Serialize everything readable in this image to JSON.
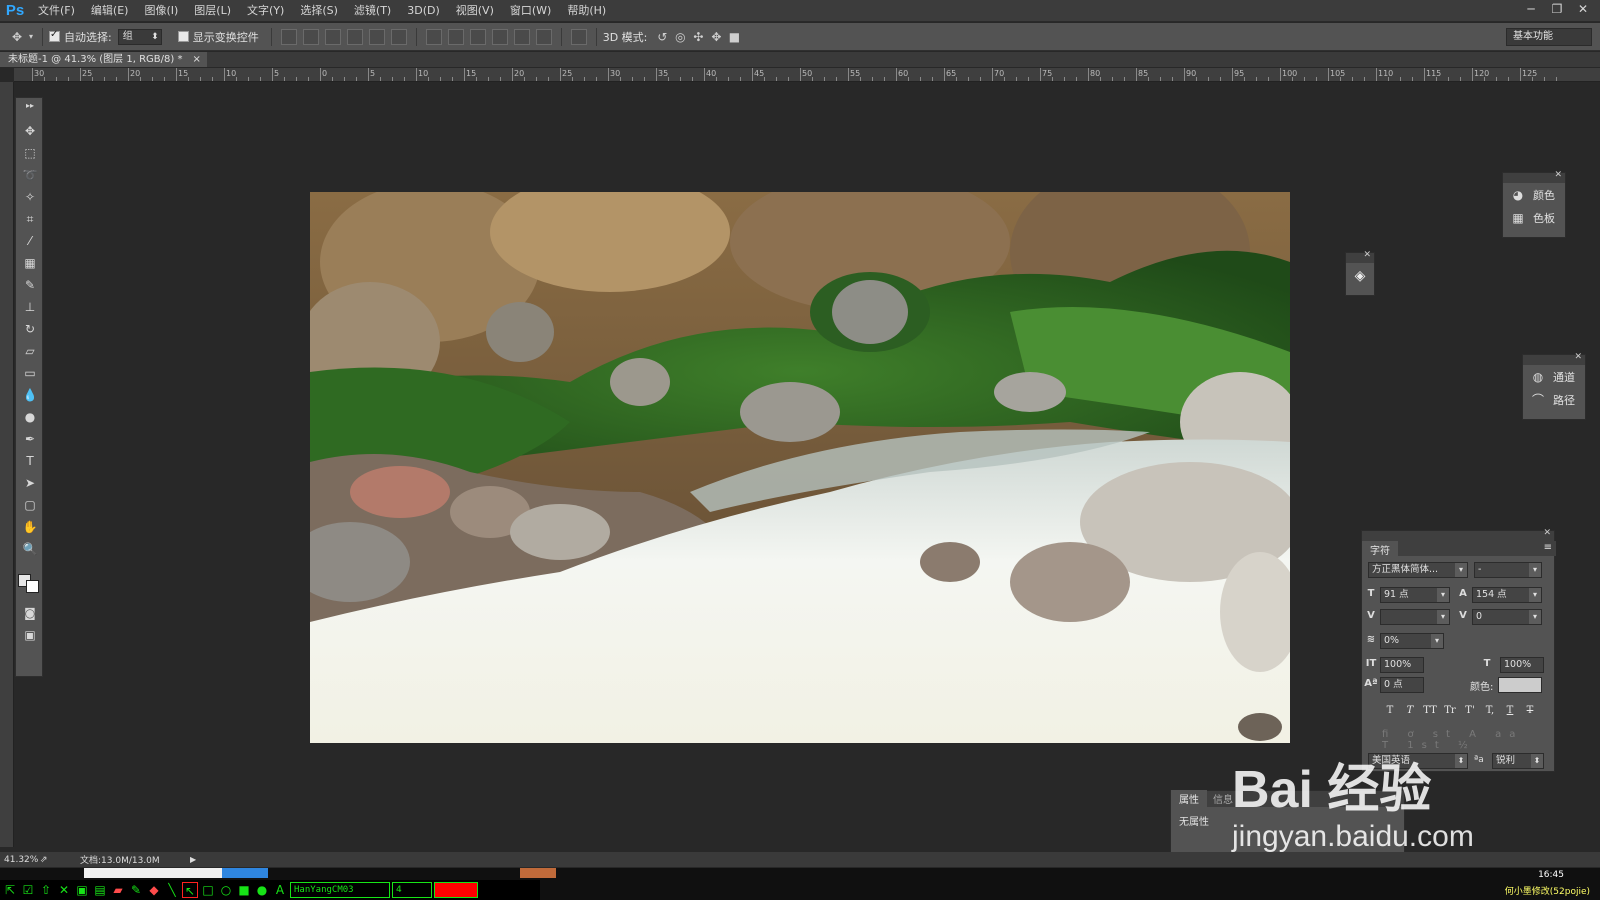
{
  "app": {
    "logo": "Ps"
  },
  "menu": [
    "文件(F)",
    "编辑(E)",
    "图像(I)",
    "图层(L)",
    "文字(Y)",
    "选择(S)",
    "滤镜(T)",
    "3D(D)",
    "视图(V)",
    "窗口(W)",
    "帮助(H)"
  ],
  "window_controls": [
    "─",
    "❐",
    "✕"
  ],
  "options": {
    "auto_select_label": "自动选择:",
    "auto_select_value": "组",
    "show_transform_label": "显示变换控件",
    "mode_3d_label": "3D 模式:",
    "workspace": "基本功能"
  },
  "document": {
    "tab_title": "未标题-1 @ 41.3% (图层 1, RGB/8) *",
    "tab_close": "×"
  },
  "ruler": {
    "top_labels": [
      "30",
      "25",
      "20",
      "15",
      "10",
      "5",
      "0",
      "5",
      "10",
      "15",
      "20",
      "25",
      "30",
      "35",
      "40",
      "45",
      "50",
      "55",
      "60",
      "65",
      "70",
      "75",
      "80",
      "85",
      "90",
      "95",
      "100",
      "105",
      "110",
      "115",
      "120",
      "125"
    ]
  },
  "panels": {
    "color": {
      "items": [
        {
          "label": "颜色",
          "icon": "palette-icon"
        },
        {
          "label": "色板",
          "icon": "swatches-icon"
        }
      ]
    },
    "channels": {
      "items": [
        {
          "label": "通道",
          "icon": "channels-icon"
        },
        {
          "label": "路径",
          "icon": "paths-icon"
        }
      ]
    },
    "character": {
      "tab": "字符",
      "font_family": "方正黑体简体...",
      "font_style": "-",
      "font_size": "91 点",
      "leading": "154 点",
      "kerning": "",
      "tracking": "0",
      "scale_percent": "0%",
      "vertical_scale": "100%",
      "horizontal_scale": "100%",
      "baseline_shift": "0 点",
      "color_label": "颜色:",
      "color_value": "#cccccc",
      "style_buttons": [
        "T",
        "T",
        "TT",
        "Tr",
        "T'",
        "T,",
        "T",
        "T"
      ],
      "language": "美国英语",
      "aa_label": "ªa",
      "antialias": "锐利"
    },
    "properties": {
      "tabs": [
        "属性",
        "信息"
      ],
      "body": "无属性"
    }
  },
  "status": {
    "zoom": "41.32%",
    "doc_size": "文档:13.0M/13.0M"
  },
  "taskbar": {
    "font_name": "HanYangCM03",
    "font_size": "4",
    "time": "16:45",
    "tray_text": "何小墨修改(52pojie)"
  },
  "watermark": {
    "logo": "Bai 经验",
    "url": "jingyan.baidu.com"
  }
}
